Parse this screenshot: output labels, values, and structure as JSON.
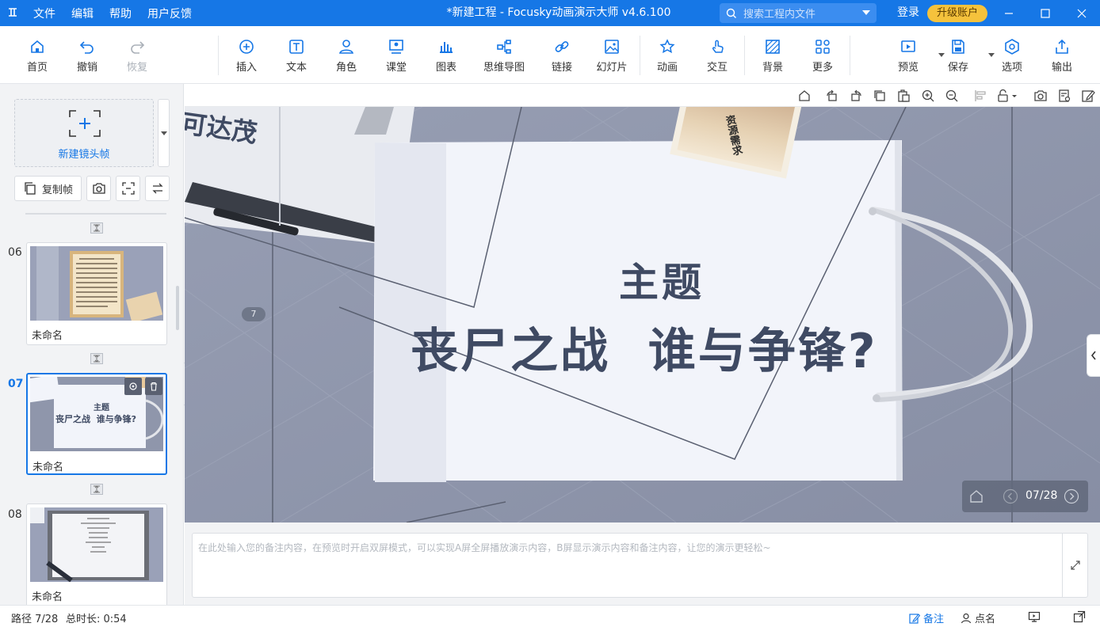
{
  "app": {
    "title": "*新建工程 - Focusky动画演示大师  v4.6.100",
    "menu": [
      "文件",
      "编辑",
      "帮助",
      "用户反馈"
    ],
    "search_placeholder": "搜索工程内文件",
    "login": "登录",
    "upgrade": "升级账户"
  },
  "toolbar": {
    "home": "首页",
    "undo": "撤销",
    "redo": "恢复",
    "insert": "插入",
    "text": "文本",
    "role": "角色",
    "classroom": "课堂",
    "chart": "图表",
    "mindmap": "思维导图",
    "link": "链接",
    "slideshow": "幻灯片",
    "animation": "动画",
    "interaction": "交互",
    "background": "背景",
    "more": "更多",
    "preview": "预览",
    "save": "保存",
    "options": "选项",
    "export": "输出"
  },
  "left_panel": {
    "new_frame": "新建镜头帧",
    "copy_frame": "复制帧",
    "slides": [
      {
        "num": "06",
        "name": "未命名",
        "active": false
      },
      {
        "num": "07",
        "name": "未命名",
        "active": true,
        "thumb_title": "主题",
        "thumb_subtitle": "丧尸之战  谁与争锋?"
      },
      {
        "num": "08",
        "name": "未命名",
        "active": false
      }
    ]
  },
  "canvas": {
    "title": "主题",
    "subtitle": "丧尸之战  谁与争锋?",
    "partial_text": "可达茂",
    "photo_text": "资源需求",
    "path_marker": "7",
    "pager": "07/28",
    "colors": {
      "background": "#8f96ab",
      "paper": "#f2f4fa",
      "text": "#3f4a63"
    }
  },
  "notes": {
    "placeholder": "在此处输入您的备注内容，在预览时开启双屏模式，可以实现A屏全屏播放演示内容，B屏显示演示内容和备注内容，让您的演示更轻松~"
  },
  "status": {
    "path": "路径 7/28",
    "duration": "总时长: 0:54",
    "notes": "备注",
    "roll_call": "点名"
  },
  "accent_color": "#1677e6"
}
